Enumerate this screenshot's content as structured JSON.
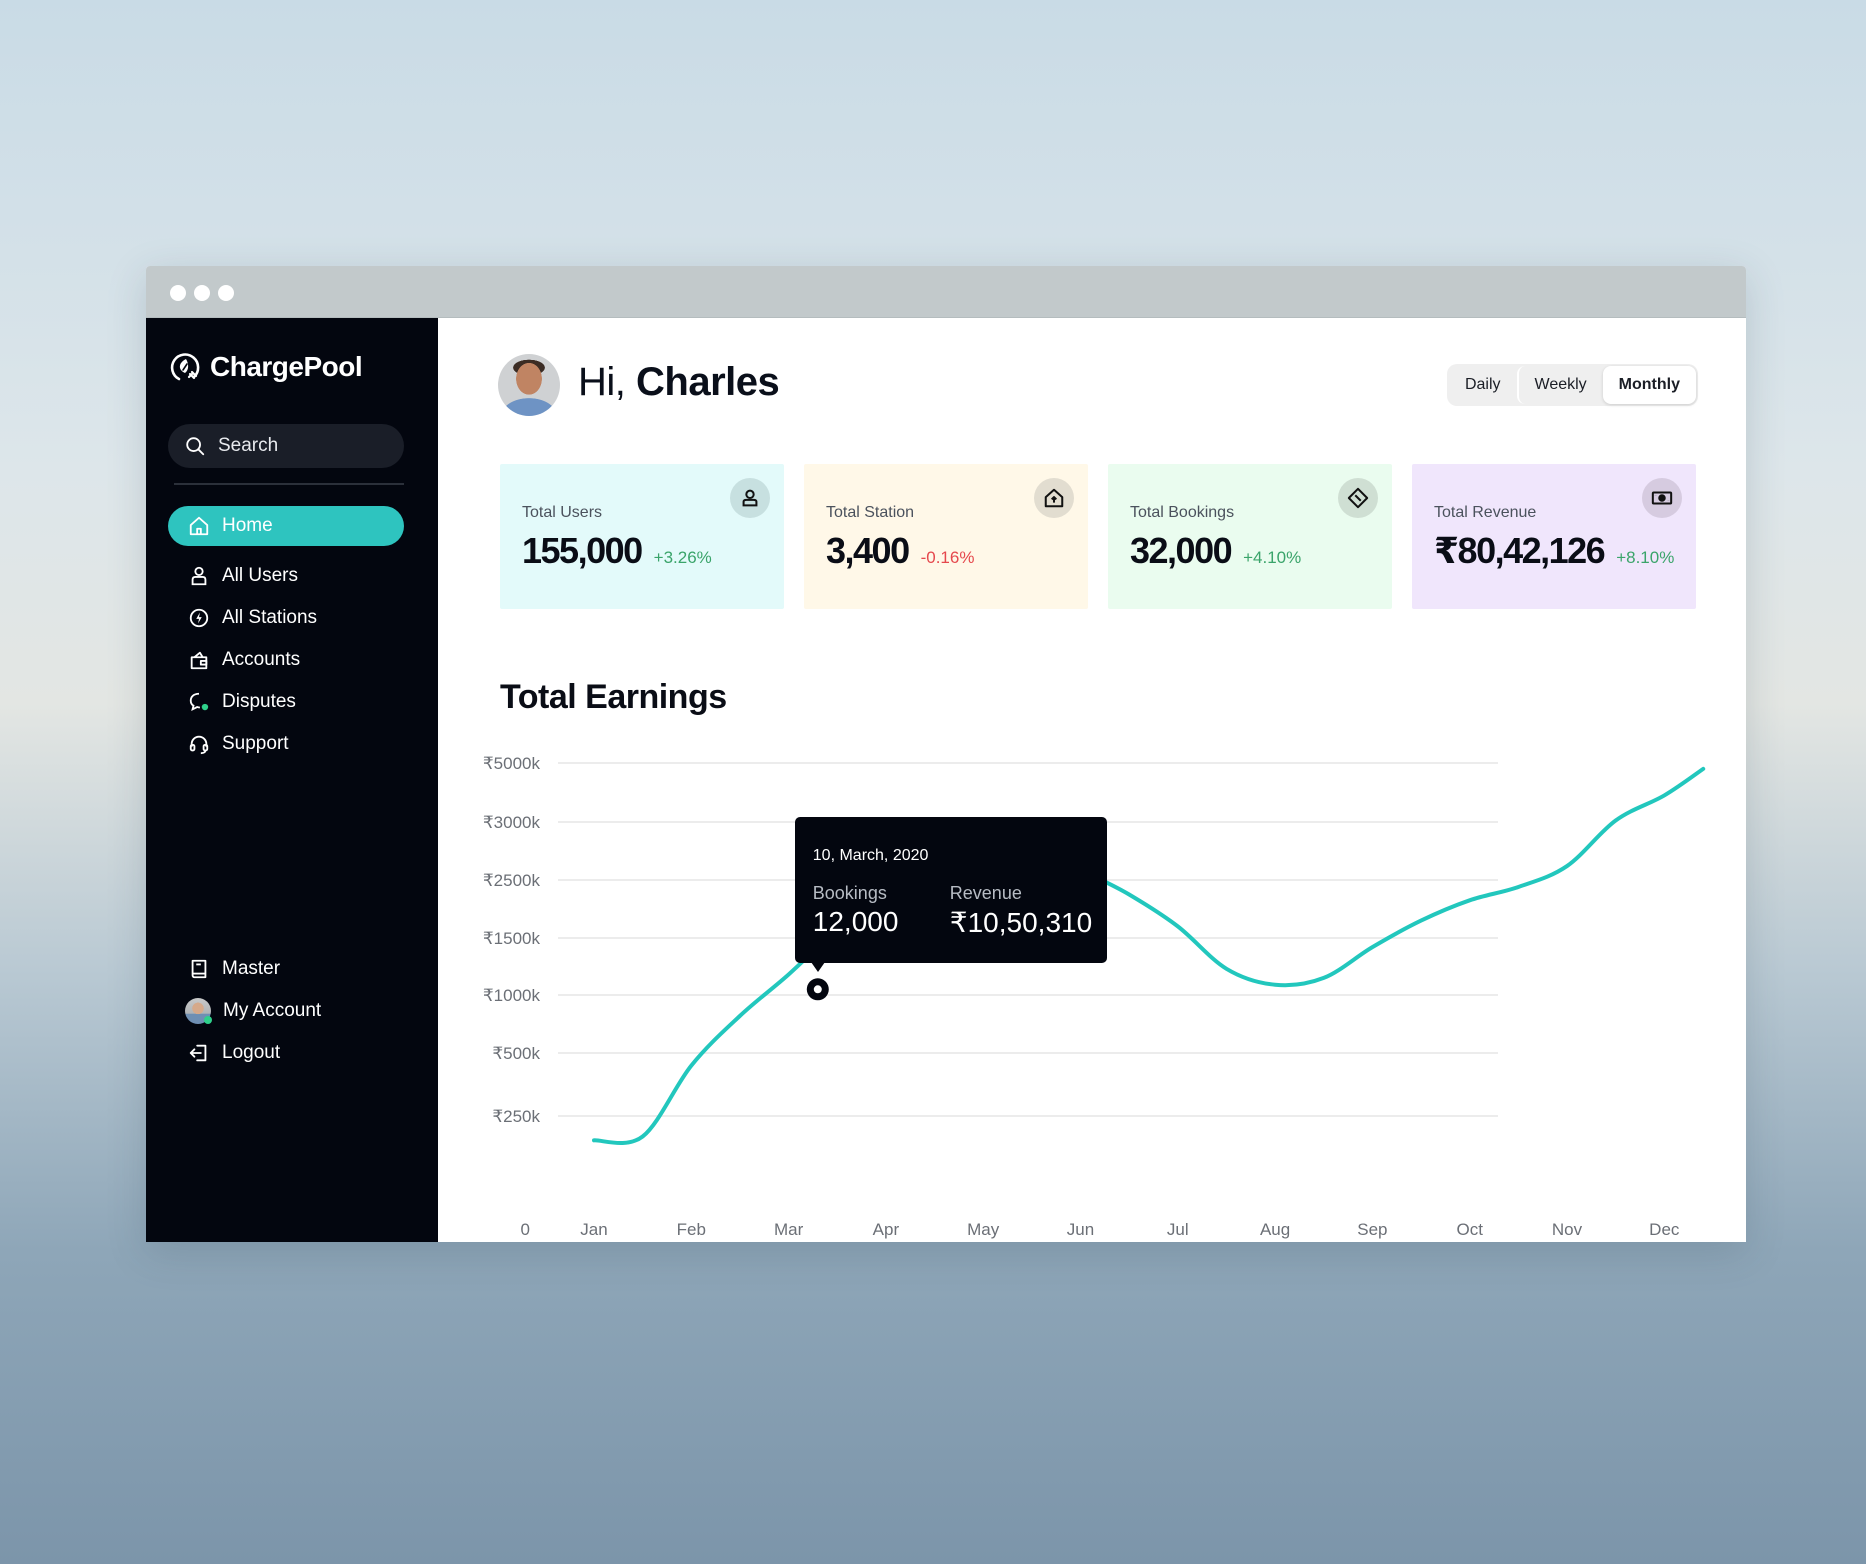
{
  "window": {
    "controls": [
      "close",
      "minimize",
      "maximize"
    ]
  },
  "sidebar": {
    "brand": "ChargePool",
    "search_placeholder": "Search",
    "items": [
      {
        "label": "Home",
        "icon": "home-icon",
        "active": true
      },
      {
        "label": "All Users",
        "icon": "user-icon"
      },
      {
        "label": "All Stations",
        "icon": "lightning-icon"
      },
      {
        "label": "Accounts",
        "icon": "wallet-icon"
      },
      {
        "label": "Disputes",
        "icon": "chat-bubble-icon"
      },
      {
        "label": "Support",
        "icon": "headset-icon"
      }
    ],
    "bottom_items": [
      {
        "label": "Master",
        "icon": "book-icon"
      },
      {
        "label": "My Account",
        "icon": "avatar"
      },
      {
        "label": "Logout",
        "icon": "logout-icon"
      }
    ]
  },
  "header": {
    "greeting": "Hi,",
    "user_name": "Charles",
    "period_options": [
      "Daily",
      "Weekly",
      "Monthly"
    ],
    "selected_period": "Monthly"
  },
  "stats": [
    {
      "label": "Total Users",
      "value": "155,000",
      "change": "+3.26%",
      "trend": "up",
      "icon": "user-icon",
      "bg": "#e3fafa",
      "icon_bg": "#c7e0e0"
    },
    {
      "label": "Total Station",
      "value": "3,400",
      "change": "-0.16%",
      "trend": "down",
      "icon": "home-upload-icon",
      "bg": "#fff8e8",
      "icon_bg": "#e2ddd0"
    },
    {
      "label": "Total Bookings",
      "value": "32,000",
      "change": "+4.10%",
      "trend": "up",
      "icon": "ticket-icon",
      "bg": "#eafcef",
      "icon_bg": "#cfdfd3"
    },
    {
      "label": "Total Revenue",
      "value": "₹80,42,126",
      "change": "+8.10%",
      "trend": "up",
      "icon": "cash-icon",
      "bg": "#f0e6fc",
      "icon_bg": "#d6cbe0"
    }
  ],
  "earnings": {
    "title": "Total Earnings",
    "tooltip": {
      "date": "10, March, 2020",
      "bookings_label": "Bookings",
      "bookings_value": "12,000",
      "revenue_label": "Revenue",
      "revenue_value": "₹10,50,310"
    }
  },
  "chart_data": {
    "type": "line",
    "title": "Total Earnings",
    "xlabel": "",
    "ylabel": "",
    "categories": [
      "Jan",
      "Feb",
      "Mar",
      "Apr",
      "May",
      "Jun",
      "Jul",
      "Aug",
      "Sep",
      "Oct",
      "Nov",
      "Dec"
    ],
    "y_ticks": [
      {
        "label": "0",
        "value": 0
      },
      {
        "label": "₹250k",
        "value": 250
      },
      {
        "label": "₹500k",
        "value": 500
      },
      {
        "label": "₹1000k",
        "value": 1000
      },
      {
        "label": "₹1500k",
        "value": 1500
      },
      {
        "label": "₹2500k",
        "value": 2500
      },
      {
        "label": "₹3000k",
        "value": 3000
      },
      {
        "label": "₹5000k",
        "value": 5000
      }
    ],
    "y_unit": "₹ thousands",
    "grid": true,
    "series": [
      {
        "name": "Earnings",
        "color": "#22c7bd",
        "x": [
          0.0,
          0.5,
          1.0,
          1.5,
          2.0,
          2.5,
          3.0,
          3.5,
          4.0,
          4.5,
          5.0,
          5.5,
          6.0,
          6.5,
          7.0,
          7.5,
          8.0,
          8.5,
          9.0,
          9.5,
          10.0,
          10.5,
          11.0,
          11.4
        ],
        "values": [
          60,
          90,
          450,
          820,
          1180,
          1650,
          2300,
          2750,
          3000,
          2900,
          2600,
          2250,
          1700,
          1230,
          1090,
          1150,
          1420,
          1800,
          2150,
          2380,
          2620,
          3050,
          3900,
          4800
        ]
      }
    ],
    "highlight": {
      "x": 2.3,
      "value": 1050,
      "label": "10, March, 2020"
    }
  }
}
